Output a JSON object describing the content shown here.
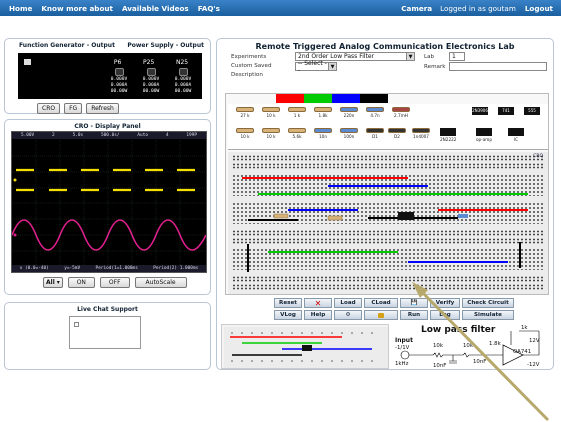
{
  "nav": {
    "home": "Home",
    "know_more": "Know more about",
    "videos": "Available Videos",
    "faqs": "FAQ's",
    "camera": "Camera",
    "logged_in": "Logged in as goutam",
    "logout": "Logout"
  },
  "function_generator": {
    "title": "Function Generator - Output",
    "power_title": "Power Supply - Output",
    "channels": [
      "P6",
      "P25",
      "N25"
    ],
    "rows": [
      [
        "0.000V",
        "0.000V",
        "0.000V"
      ],
      [
        "0.000A",
        "0.000A",
        "0.000A"
      ],
      [
        "00.00W",
        "00.00W",
        "00.00W"
      ]
    ],
    "buttons": [
      "CRO",
      "FG",
      "Refresh"
    ]
  },
  "cro": {
    "title": "CRO - Display Panel",
    "top_bar": [
      "5.00V",
      "2",
      "5.0s",
      "500.0s/",
      "Auto",
      "4",
      "199P"
    ],
    "bottom_bar": [
      "x (0.0=-40)",
      "y=-5mV",
      "Period(1=1.000ms",
      "Period(2) 1.000ms"
    ],
    "channel_select": "All",
    "buttons": {
      "on": "ON",
      "off": "OFF",
      "autoscale": "AutoScale"
    },
    "trace_colors": {
      "ch1": "#f5e000",
      "ch2": "#e0208f"
    }
  },
  "chat": {
    "title": "Live Chat Support"
  },
  "lab": {
    "title": "Remote Triggered Analog Communication Electronics Lab",
    "experiments_label": "Experiments",
    "experiment_value": "2nd Order Low Pass Filter",
    "custom_label": "Custom Saved",
    "custom_value": "-- Select --",
    "description_label": "Description",
    "lab_label": "Lab",
    "lab_value": "1",
    "remark_label": "Remark",
    "color_swatches": [
      "#ff0000",
      "#00cc00",
      "#0000ff",
      "#000000"
    ],
    "components": [
      "27 k",
      "10 k",
      "1 k",
      "1.8k",
      "220n",
      "4.7n",
      "2.7mH",
      "10 k",
      "10 k",
      "5.6k",
      "10n",
      "100n",
      "D1",
      "D2",
      "1n4007",
      "2N2222",
      "op-amp",
      "IC"
    ],
    "chips": [
      "2N3906",
      "741",
      "555"
    ],
    "board_label": "CRO",
    "toolbar": {
      "reset": "Reset",
      "close_symbol": "✕",
      "load": "Load",
      "cload": "CLoad",
      "save_symbol": "💾",
      "verify": "Verify",
      "check_circuit": "Check Circuit",
      "vlog": "VLog",
      "help": "Help",
      "run": "Run",
      "log": "Log",
      "simulate": "Simulate"
    },
    "filter": {
      "heading": "Low pass filter",
      "input_label": "Input",
      "input_range": "-1/1V",
      "freq": "1kHz",
      "r1": "10k",
      "r2": "10k",
      "r3": "1.8k",
      "rf": "1k",
      "c1": "10nF",
      "c2": "10nF",
      "vplus": "12V",
      "vminus": "-12V",
      "opamp": "OA741"
    }
  }
}
